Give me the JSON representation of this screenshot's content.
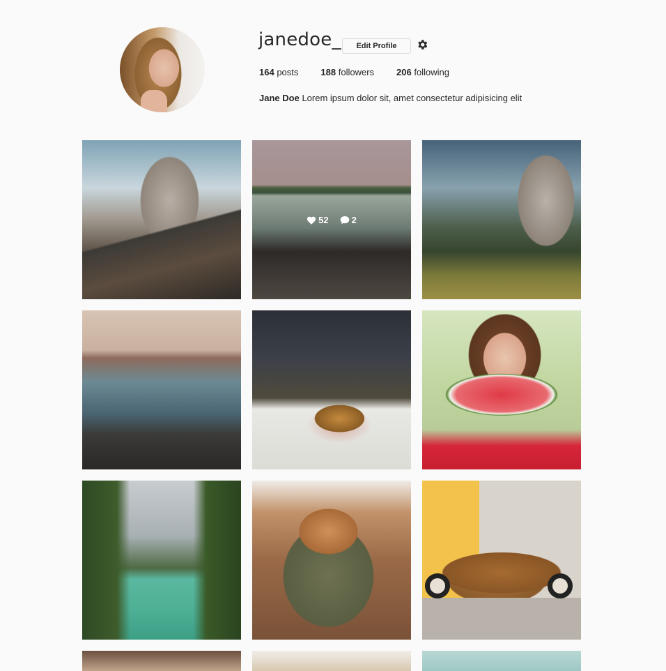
{
  "profile": {
    "username": "janedoe_",
    "edit_button": "Edit Profile",
    "stats": {
      "posts_count": "164",
      "posts_label": "posts",
      "followers_count": "188",
      "followers_label": "followers",
      "following_count": "206",
      "following_label": "following"
    },
    "bio": {
      "name": "Jane Doe",
      "text": "Lorem ipsum dolor sit, amet consectetur adipisicing elit"
    }
  },
  "icons": {
    "settings": "gear-icon",
    "likes": "heart-icon",
    "comments": "comment-icon"
  },
  "posts": [
    {
      "subject": "mountain road"
    },
    {
      "subject": "lake with family",
      "hover": true,
      "likes": "52",
      "comments": "2"
    },
    {
      "subject": "cliff and pines"
    },
    {
      "subject": "seagull golden gate"
    },
    {
      "subject": "burger"
    },
    {
      "subject": "watermelon smile"
    },
    {
      "subject": "tropical lagoon"
    },
    {
      "subject": "puppy in backpack"
    },
    {
      "subject": "vintage beetle car"
    },
    {
      "subject": "partial"
    },
    {
      "subject": "partial"
    },
    {
      "subject": "partial"
    }
  ]
}
